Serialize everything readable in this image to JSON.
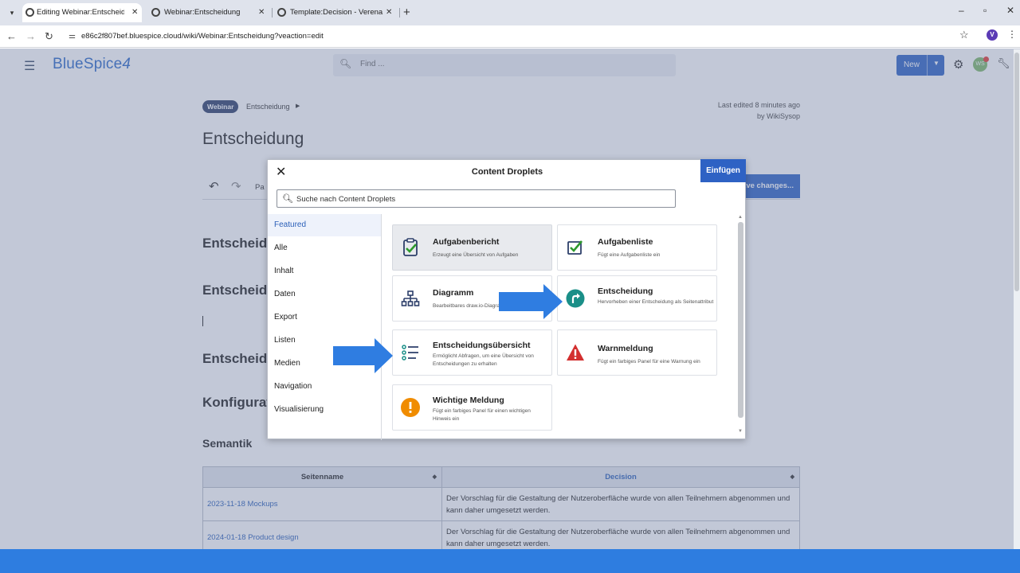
{
  "browser": {
    "tabs": [
      {
        "title": "Editing Webinar:Entscheidung"
      },
      {
        "title": "Webinar:Entscheidung"
      },
      {
        "title": "Template:Decision - Verena"
      }
    ],
    "url": "e86c2f807bef.bluespice.cloud/wiki/Webinar:Entscheidung?veaction=edit",
    "profile_initial": "V"
  },
  "app": {
    "logo": "BlueSpice",
    "logo_num": "4",
    "search_placeholder": "Find ...",
    "new_button": "New",
    "avatar_initials": "WS"
  },
  "page": {
    "badge": "Webinar",
    "breadcrumb": "Entscheidung",
    "last_edited_line1": "Last edited 8 minutes ago",
    "last_edited_line2": "by WikiSysop",
    "title": "Entscheidung",
    "toolbar_para": "Pa",
    "save_button": "ave changes...",
    "headings": [
      "Entscheidung",
      "Entscheidung",
      "Entscheidung",
      "Konfiguration"
    ],
    "semantik": "Semantik",
    "table": {
      "headers": [
        "Seitenname",
        "Decision"
      ],
      "rows": [
        {
          "name": "2023-11-18 Mockups",
          "decision": "Der Vorschlag für die Gestaltung der Nutzeroberfläche wurde von allen Teilnehmern abgenommen und kann daher umgesetzt werden."
        },
        {
          "name": "2024-01-18 Product design",
          "decision": "Der Vorschlag für die Gestaltung der Nutzeroberfläche wurde von allen Teilnehmern abgenommen und kann daher umgesetzt werden."
        }
      ]
    }
  },
  "modal": {
    "title": "Content Droplets",
    "insert": "Einfügen",
    "search_placeholder": "Suche nach Content Droplets",
    "nav": [
      "Featured",
      "Alle",
      "Inhalt",
      "Daten",
      "Export",
      "Listen",
      "Medien",
      "Navigation",
      "Visualisierung"
    ],
    "cards": [
      {
        "title": "Aufgabenbericht",
        "desc": "Erzeugt eine Übersicht von Aufgaben",
        "icon": "clipboard-check-icon"
      },
      {
        "title": "Aufgabenliste",
        "desc": "Fügt eine Aufgabenliste ein",
        "icon": "checkbox-icon"
      },
      {
        "title": "Diagramm",
        "desc": "Bearbeitbares draw.io-Diagramm",
        "icon": "sitemap-icon"
      },
      {
        "title": "Entscheidung",
        "desc": "Hervorheben einer Entscheidung als Seitenattribut",
        "icon": "decision-arrow-icon"
      },
      {
        "title": "Entscheidungsübersicht",
        "desc": "Ermöglicht Abfragen, um eine Übersicht von Entscheidungen zu erhalten",
        "icon": "list-icon"
      },
      {
        "title": "Warnmeldung",
        "desc": "Fügt ein farbiges Panel für eine Warnung ein",
        "icon": "warning-icon"
      },
      {
        "title": "Wichtige Meldung",
        "desc": "Fügt ein farbiges Panel für einen wichtigen Hinweis ein",
        "icon": "exclamation-icon"
      }
    ]
  },
  "colors": {
    "accent": "#2e62c4",
    "arrow": "#2f7de1",
    "teal": "#1a8f88",
    "warning": "#d32f2f",
    "orange": "#f08c00"
  }
}
